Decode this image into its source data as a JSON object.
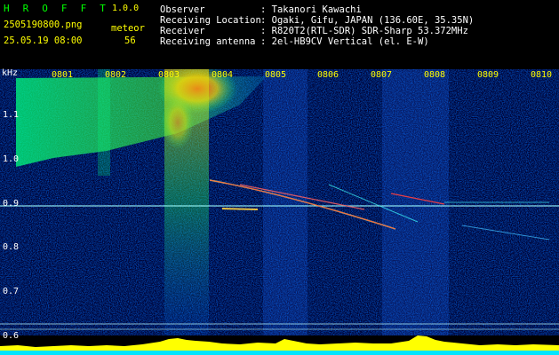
{
  "header": {
    "app_title": "H R O F F T",
    "version": "1.0.0",
    "filename": "2505190800.png",
    "datetime": "25.05.19 08:00",
    "meteor_label": "meteor",
    "meteor_count": "56",
    "info": [
      {
        "label": "Observer",
        "value": ": Takanori Kawachi"
      },
      {
        "label": "Receiving Location",
        "value": ": Ogaki, Gifu, JAPAN (136.60E, 35.35N)"
      },
      {
        "label": "Receiver",
        "value": ": R820T2(RTL-SDR) SDR-Sharp 53.372MHz"
      },
      {
        "label": "Receiving antenna",
        "value": ": 2el-HB9CV Vertical (el. E-W)"
      }
    ]
  },
  "spectrogram": {
    "unit": "kHz",
    "freq_labels": [
      "1.1",
      "1.0",
      "0.9",
      "0.8",
      "0.7",
      "0.6"
    ],
    "time_labels": [
      "0801",
      "0802",
      "0803",
      "0804",
      "0805",
      "0806",
      "0807",
      "0808",
      "0809",
      "0810"
    ],
    "colors": {
      "background": "#000020",
      "noise": "#0033cc",
      "strong": "#ff2020",
      "level_bar": "#ffff00",
      "baseline": "#00e5ff"
    }
  }
}
